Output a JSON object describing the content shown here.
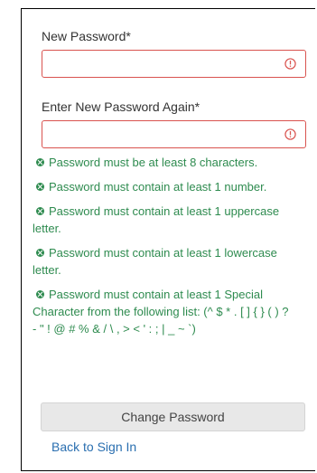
{
  "form": {
    "new_password_label": "New Password*",
    "new_password_value": "",
    "confirm_password_label": "Enter New Password Again*",
    "confirm_password_value": ""
  },
  "requirements": [
    "Password must be at least 8 characters.",
    "Password must contain at least 1 number.",
    "Password must contain at least 1 uppercase letter.",
    "Password must contain at least 1 lowercase letter.",
    "Password must contain at least 1 Special Character from the following list: (^ $ * . [ ] { } ( ) ? - \" ! @ # % & / \\ , > < ' : ; | _ ~ `)"
  ],
  "actions": {
    "change_password_label": "Change Password",
    "back_link_label": "Back to Sign In"
  },
  "colors": {
    "error": "#d9534f",
    "requirement": "#2e8b4f",
    "link": "#2a6fb0"
  },
  "icons": {
    "field_error": "error-circle-icon",
    "requirement": "x-circle-icon"
  }
}
